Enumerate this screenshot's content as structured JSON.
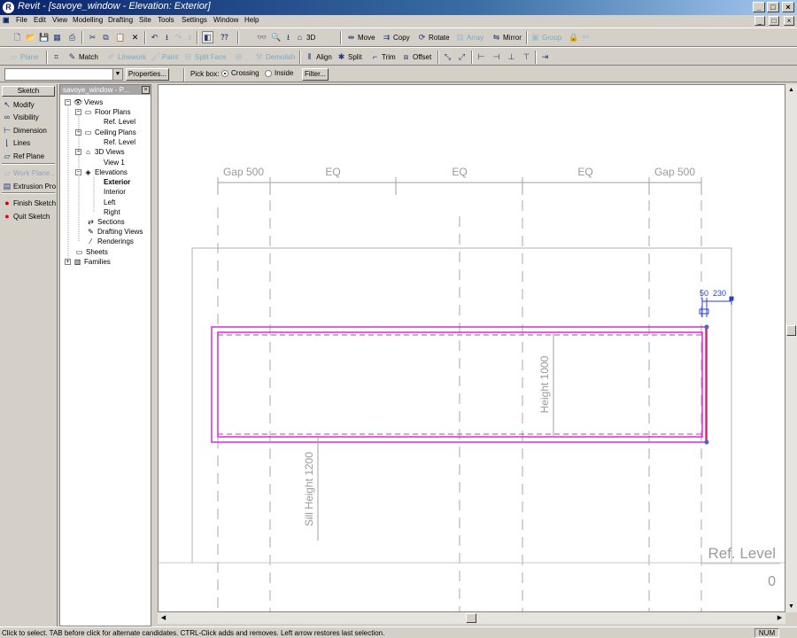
{
  "window": {
    "title": "Revit - [savoye_window - Elevation: Exterior]",
    "logo": "R",
    "controls": [
      "_",
      "□",
      "×"
    ]
  },
  "menubar": {
    "items": [
      "File",
      "Edit",
      "View",
      "Modelling",
      "Drafting",
      "Site",
      "Tools",
      "Settings",
      "Window",
      "Help"
    ],
    "mdi_controls": [
      "_",
      "□",
      "×"
    ]
  },
  "toolbar1": {
    "move": "Move",
    "copy": "Copy",
    "rotate": "Rotate",
    "array": "Array",
    "mirror": "Mirror",
    "group": "Group",
    "view_3d": "3D"
  },
  "toolbar2": {
    "plane": "Plane",
    "match": "Match",
    "linework": "Linework",
    "paint": "Paint",
    "split_face": "Split Face",
    "demolish": "Demolish",
    "align": "Align",
    "split": "Split",
    "trim": "Trim",
    "offset": "Offset"
  },
  "optionsbar": {
    "type_selector_value": "",
    "properties_label": "Properties...",
    "pick_box_label": "Pick box:",
    "crossing_label": "Crossing",
    "inside_label": "Inside",
    "crossing_selected": true,
    "filter_label": "Filter..."
  },
  "sketch_panel": {
    "tab_label": "Sketch",
    "items": [
      {
        "label": "Modify",
        "icon": "cursor-icon",
        "enabled": true
      },
      {
        "label": "Visibility",
        "icon": "glasses-icon",
        "enabled": true
      },
      {
        "label": "Dimension",
        "icon": "dimension-icon",
        "enabled": true
      },
      {
        "label": "Lines",
        "icon": "lines-icon",
        "enabled": true
      },
      {
        "label": "Ref Plane",
        "icon": "ref-plane-icon",
        "enabled": true
      },
      {
        "label": "Work Plane...",
        "icon": "work-plane-icon",
        "enabled": false
      },
      {
        "label": "Extrusion Pro",
        "icon": "extrusion-properties-icon",
        "enabled": true
      },
      {
        "label": "Finish Sketch",
        "icon": "finish-sketch-icon",
        "enabled": true
      },
      {
        "label": "Quit Sketch",
        "icon": "quit-sketch-icon",
        "enabled": true
      }
    ]
  },
  "project_browser": {
    "title": "savoye_window - P...",
    "close": "×",
    "tree": [
      {
        "label": "Views",
        "sign": "−"
      },
      {
        "label": "Floor Plans",
        "sign": "−"
      },
      {
        "label": "Ref. Level"
      },
      {
        "label": "Ceiling Plans",
        "sign": "−"
      },
      {
        "label": "Ref. Level"
      },
      {
        "label": "3D Views",
        "sign": "−"
      },
      {
        "label": "View 1"
      },
      {
        "label": "Elevations",
        "sign": "−"
      },
      {
        "label": "Exterior",
        "active": true
      },
      {
        "label": "Interior"
      },
      {
        "label": "Left"
      },
      {
        "label": "Right"
      },
      {
        "label": "Sections"
      },
      {
        "label": "Drafting Views"
      },
      {
        "label": "Renderings"
      },
      {
        "label": "Sheets"
      },
      {
        "label": "Families",
        "sign": "+"
      }
    ]
  },
  "drawing": {
    "dims_top": [
      "Gap 500",
      "EQ",
      "EQ",
      "EQ",
      "Gap 500"
    ],
    "dim_height": "Height 1000",
    "dim_sill": "Sill Height 1200",
    "dim_small_1": "50",
    "dim_small_2": "230",
    "level_name": "Ref. Level",
    "level_value": "0",
    "colors": {
      "sketch_lines": "#d030d0",
      "highlight": "#e02020",
      "dimension_selected": "#2a3fd0",
      "ref_planes": "#b0b0b0"
    }
  },
  "scrollbars": {
    "up": "▲",
    "down": "▼",
    "left": "◀",
    "right": "▶"
  },
  "status": {
    "message": "Click to select. TAB before click for alternate candidates. CTRL-Click adds and removes. Left arrow restores last selection.",
    "num": "NUM"
  }
}
